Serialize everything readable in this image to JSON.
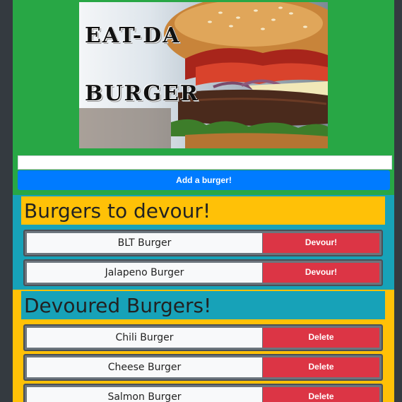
{
  "hero": {
    "title_line1": "EAT-DA",
    "title_line2": "BURGER"
  },
  "form": {
    "input_value": "",
    "input_placeholder": "",
    "add_button_label": "Add a burger!"
  },
  "to_devour": {
    "heading": "Burgers to devour!",
    "button_label": "Devour!",
    "items": [
      {
        "name": "BLT Burger"
      },
      {
        "name": "Jalapeno Burger"
      }
    ]
  },
  "devoured": {
    "heading": "Devoured Burgers!",
    "button_label": "Delete",
    "items": [
      {
        "name": "Chili Burger"
      },
      {
        "name": "Cheese Burger"
      },
      {
        "name": "Salmon Burger"
      }
    ]
  },
  "colors": {
    "page_bg": "#343a40",
    "container_bg": "#28a745",
    "primary": "#007bff",
    "danger": "#dc3545",
    "info": "#17a2b8",
    "warning": "#ffc107"
  }
}
